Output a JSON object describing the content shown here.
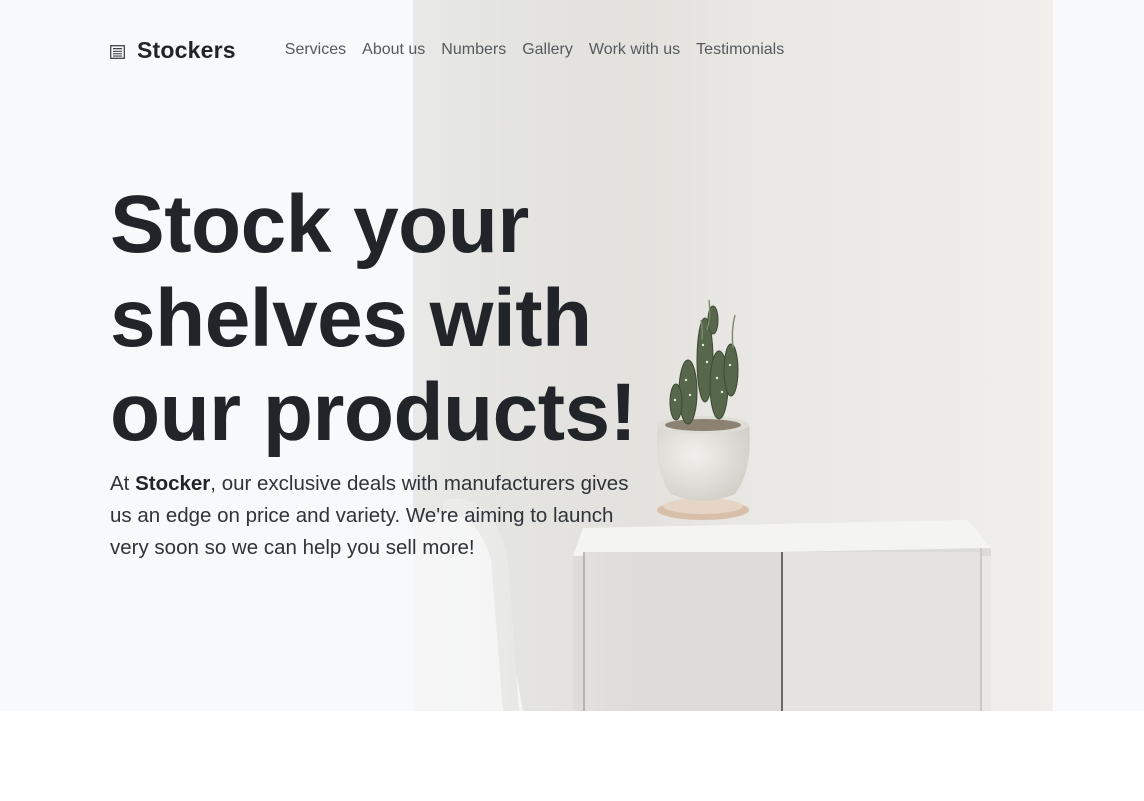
{
  "brand": {
    "icon": "newspaper-icon",
    "name": "Stockers"
  },
  "nav": {
    "items": [
      {
        "label": "Services"
      },
      {
        "label": "About us"
      },
      {
        "label": "Numbers"
      },
      {
        "label": "Gallery"
      },
      {
        "label": "Work with us"
      },
      {
        "label": "Testimonials"
      }
    ]
  },
  "hero": {
    "headline_lines": [
      "Stock your",
      "shelves with",
      "our products!"
    ],
    "lead_prefix": "At ",
    "lead_brand": "Stocker",
    "lead_text": ", our exclusive deals with manufacturers gives us an edge on price and variety. We're aiming to launch very soon so we can help you sell more!"
  },
  "colors": {
    "text_dark": "#212529",
    "nav_text": "#555a5f",
    "hero_bg": "#f8f9fb"
  }
}
